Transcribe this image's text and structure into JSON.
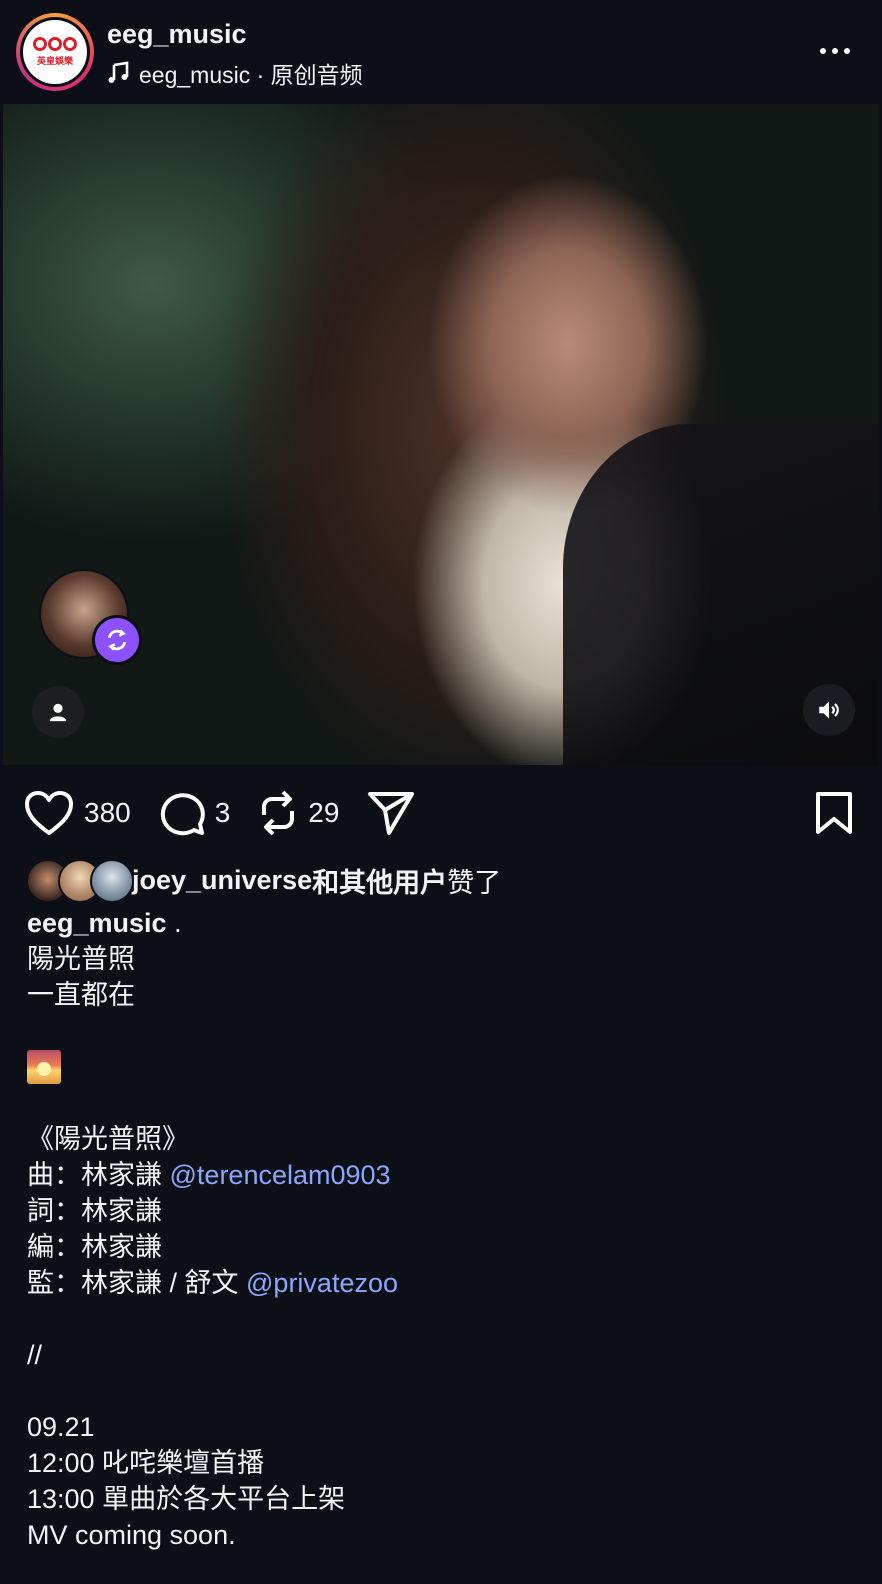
{
  "header": {
    "username": "eeg_music",
    "audio_text": "eeg_music · 原创音频",
    "logo_text": "英皇娛樂"
  },
  "actions": {
    "likes": "380",
    "comments": "3",
    "reposts": "29"
  },
  "liked_by": {
    "user": "joey_universe",
    "rest": "和其他用户",
    "suffix": "赞了"
  },
  "caption": {
    "author": "eeg_music",
    "author_suffix": " .",
    "lines": {
      "l1": "陽光普照",
      "l2": "一直都在",
      "l4": "《陽光普照》",
      "l5_prefix": "曲：林家謙 ",
      "l5_mention": "@terencelam0903",
      "l6": "詞：林家謙",
      "l7": "編：林家謙",
      "l8_prefix": "監：林家謙 / 舒文 ",
      "l8_mention": "@privatezoo",
      "l9": "//",
      "l10": "09.21",
      "l11": "12:00 叱咤樂壇首播",
      "l12": "13:00 單曲於各大平台上架",
      "l13": "MV coming soon."
    }
  },
  "colors": {
    "background": "#0c1016",
    "mention": "#8aa6ff",
    "repost_badge": "#8c52ff"
  }
}
